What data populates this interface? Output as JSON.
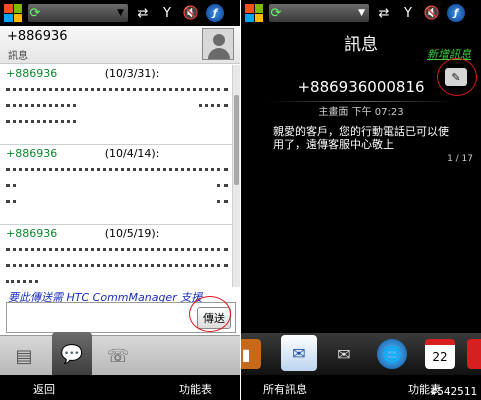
{
  "left": {
    "status_bar": {
      "icons": [
        "windows-flag-icon",
        "sync-icon",
        "dropdown-icon",
        "data-transfer-icon",
        "signal-icon",
        "speaker-mute-icon",
        "comm-manager-icon"
      ]
    },
    "header": {
      "number": "+886936",
      "label": "訊息"
    },
    "messages": [
      {
        "number": "+886936",
        "date": "(10/3/31):"
      },
      {
        "number": "+886936",
        "date": "(10/4/14):"
      },
      {
        "number": "+886936",
        "date": "(10/5/19):"
      }
    ],
    "htc_link": "要此傳送需 HTC CommManager 支援",
    "send_label": "傳送",
    "softkeys": {
      "left": "返回",
      "right": "功能表"
    }
  },
  "right": {
    "title": "訊息",
    "new_message": "新增訊息",
    "number": "+886936000816",
    "time": "主畫面 下午 07:23",
    "body": "親愛的客戶，您的行動電話已可以使用了，遠傳客服中心敬上",
    "page": "1 / 17",
    "softkeys": {
      "left": "所有訊息",
      "right": "功能表"
    },
    "watermark": "#542511"
  },
  "colors": {
    "accent_green": "#0a8a2a",
    "link_blue": "#1a2fb8",
    "highlight_red": "#e0141a",
    "new_message_green": "#3fcc3f"
  }
}
